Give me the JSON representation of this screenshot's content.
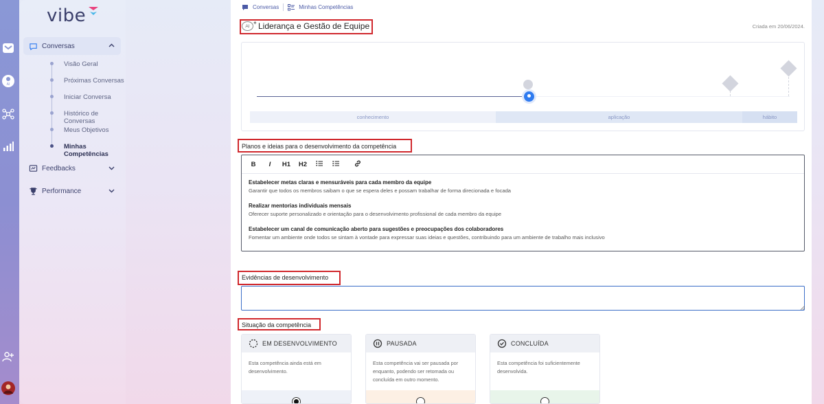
{
  "brand": {
    "logo_text": "vibe"
  },
  "sidebar": {
    "groups": [
      {
        "label": "Conversas",
        "icon": "chat-bubble-icon",
        "expanded": true
      },
      {
        "label": "Feedbacks",
        "icon": "feedback-icon",
        "expanded": false
      },
      {
        "label": "Performance",
        "icon": "trophy-icon",
        "expanded": false
      }
    ],
    "conversas_items": [
      {
        "label": "Visão Geral"
      },
      {
        "label": "Próximas Conversas"
      },
      {
        "label": "Iniciar Conversa"
      },
      {
        "label": "Histórico de Conversas"
      },
      {
        "label": "Meus Objetivos"
      },
      {
        "label": "Minhas Competências",
        "current": true
      }
    ]
  },
  "breadcrumb": {
    "item1": "Conversas",
    "item2": "Minhas Competências"
  },
  "competency": {
    "ai_badge": "AI",
    "title": "Liderança e Gestão de Equipe",
    "created": "Criada em 20/06/2024."
  },
  "progress": {
    "stages": [
      "conhecimento",
      "aplicação",
      "hábito"
    ],
    "current_stage": "aplicação",
    "level": 0.5
  },
  "plans": {
    "label": "Planos e ideias para o desenvolvimento da competência",
    "toolbar": [
      "B",
      "I",
      "H1",
      "H2"
    ],
    "items": [
      {
        "title": "Estabelecer metas claras e mensuráveis para cada membro da equipe",
        "desc": "Garantir que todos os membros saibam o que se espera deles e possam trabalhar de forma direcionada e focada"
      },
      {
        "title": "Realizar mentorias individuais mensais",
        "desc": "Oferecer suporte personalizado e orientação para o desenvolvimento profissional de cada membro da equipe"
      },
      {
        "title": "Estabelecer um canal de comunicação aberto para sugestões e preocupações dos colaboradores",
        "desc": "Fomentar um ambiente onde todos se sintam à vontade para expressar suas ideias e questões, contribuindo para um ambiente de trabalho mais inclusivo"
      }
    ]
  },
  "evidence": {
    "label": "Evidências de desenvolvimento",
    "value": ""
  },
  "situation": {
    "label": "Situação da competência",
    "options": [
      {
        "title": "EM DESENVOLVIMENTO",
        "desc": "Esta competência ainda está em desenvolvimento.",
        "selected": true,
        "color": "#eef1f8"
      },
      {
        "title": "PAUSADA",
        "desc": "Esta competência vai ser pausada por enquanto, podendo ser retomada ou concluída em outro momento.",
        "selected": false,
        "color": "#fdf0e4"
      },
      {
        "title": "CONCLUÍDA",
        "desc": "Esta competência foi suficientemente desenvolvida.",
        "selected": false,
        "color": "#e8f5ea"
      }
    ]
  },
  "colors": {
    "accent": "#2f7bf0",
    "highlight": "#d0272c",
    "sidebar_text": "#3a3f6b"
  }
}
